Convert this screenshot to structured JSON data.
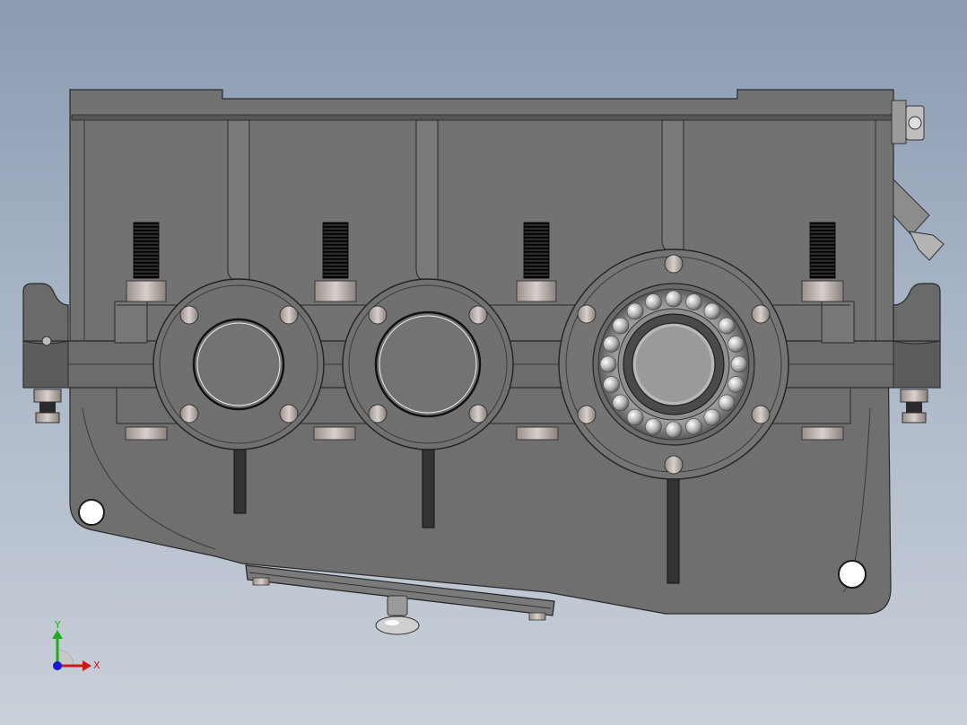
{
  "viewport": {
    "background_top": "#8a9bb1",
    "background_bottom": "#c9d0d8"
  },
  "model": {
    "housing_color": "#6f6f6f",
    "edge_color": "#2a2a2a",
    "bearing_housings": [
      {
        "kind": "plain-cover"
      },
      {
        "kind": "plain-cover"
      },
      {
        "kind": "bearing-exposed"
      }
    ]
  },
  "triad": {
    "x_label": "X",
    "y_label": "Y",
    "x_color": "#d01818",
    "y_color": "#18b018",
    "z_color": "#1818d0"
  }
}
